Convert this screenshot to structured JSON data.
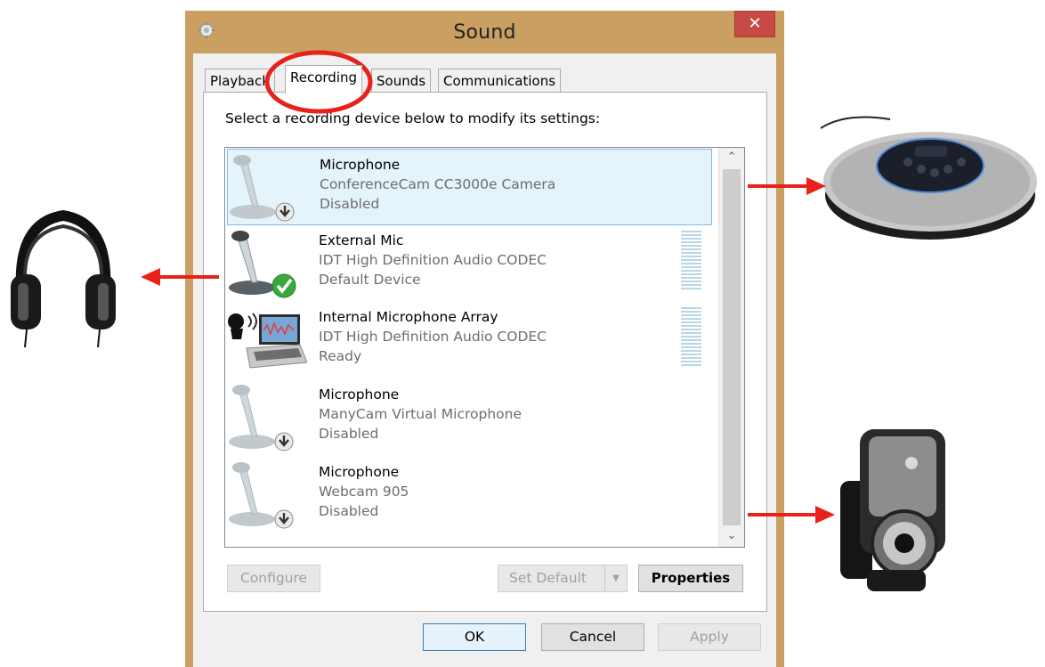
{
  "window": {
    "title": "Sound",
    "close_label": "✕"
  },
  "tabs": [
    {
      "label": "Playback"
    },
    {
      "label": "Recording"
    },
    {
      "label": "Sounds"
    },
    {
      "label": "Communications"
    }
  ],
  "recording": {
    "instruction": "Select a recording device below to modify its settings:",
    "devices": [
      {
        "name": "Microphone",
        "description": "ConferenceCam CC3000e Camera",
        "status": "Disabled",
        "icon": "microphone-disabled-icon",
        "selected": true
      },
      {
        "name": "External Mic",
        "description": "IDT High Definition Audio CODEC",
        "status": "Default Device",
        "icon": "microphone-default-icon",
        "level_meter": true
      },
      {
        "name": "Internal Microphone Array",
        "description": "IDT High Definition Audio CODEC",
        "status": "Ready",
        "icon": "laptop-microphone-icon",
        "level_meter": true
      },
      {
        "name": "Microphone",
        "description": "ManyCam Virtual Microphone",
        "status": "Disabled",
        "icon": "microphone-disabled-icon"
      },
      {
        "name": "Microphone",
        "description": "Webcam 905",
        "status": "Disabled",
        "icon": "microphone-disabled-icon"
      }
    ],
    "buttons": {
      "configure": "Configure",
      "set_default": "Set Default",
      "properties": "Properties"
    }
  },
  "dialog_buttons": {
    "ok": "OK",
    "cancel": "Cancel",
    "apply": "Apply"
  },
  "colors": {
    "annotation_red": "#e8221b",
    "close_red": "#c74a45",
    "selection": "#e5f3fb"
  }
}
